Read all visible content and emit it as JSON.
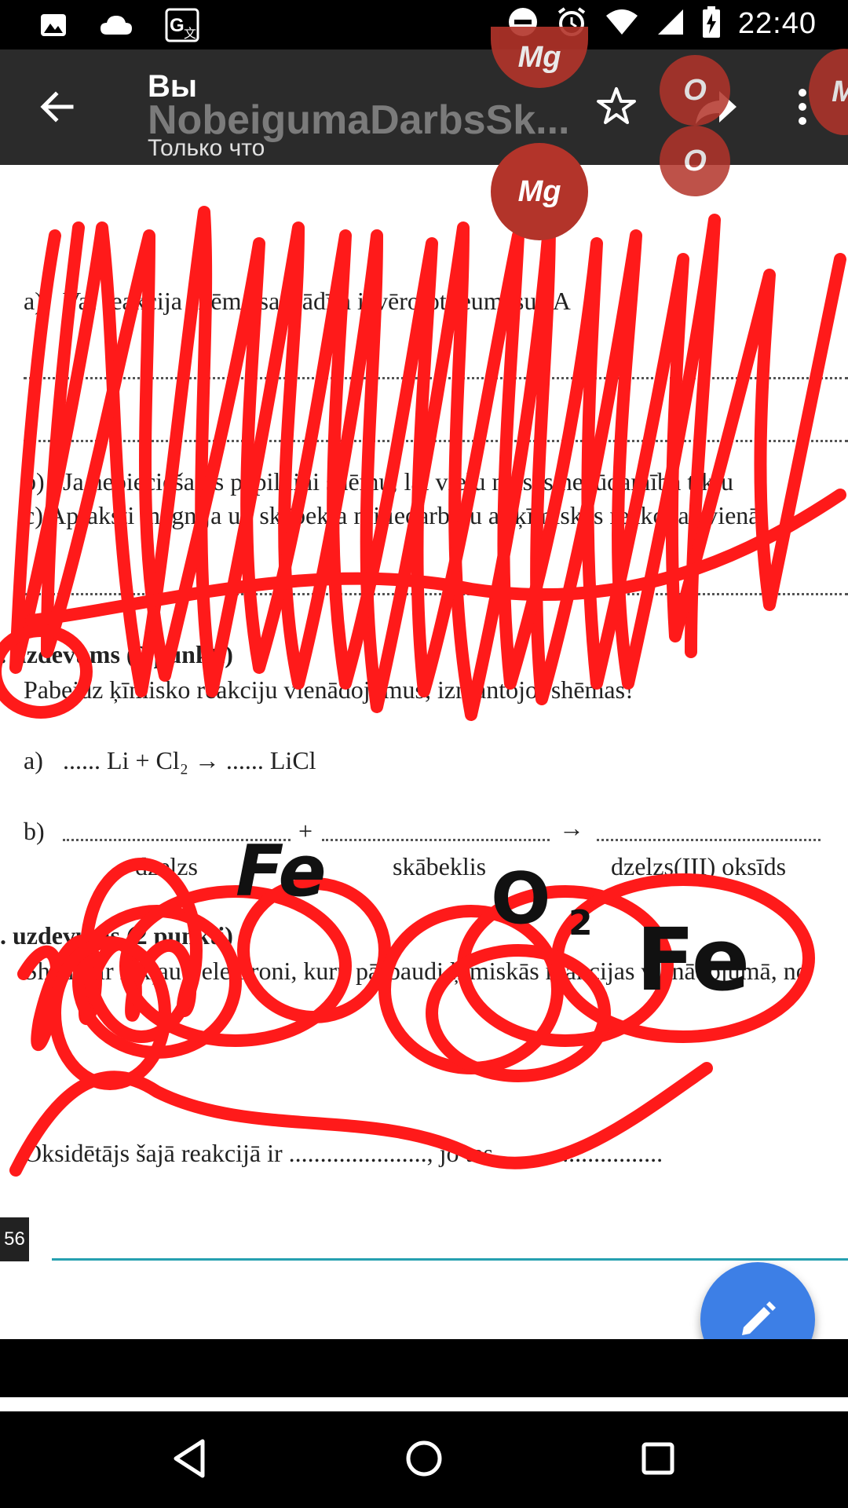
{
  "status_bar": {
    "time": "22:40",
    "icons": [
      "image-icon",
      "cloud-icon",
      "translate-icon",
      "dnd-icon",
      "alarm-icon",
      "wifi-icon",
      "signal-icon",
      "battery-charging-icon"
    ]
  },
  "app_bar": {
    "sender": "Вы",
    "document_title": "NobeigumaDarbsSk...",
    "time_label": "Только что"
  },
  "document": {
    "line_a": "a)",
    "line_a_text": "Vai reakcija shēma sasvādīta ievērojot ieumasu? A",
    "line_b": "b)",
    "line_b_text": "Ja nepieciešams papildini shēmu, lai vielu masas nezūdamība tiktu",
    "line_c_text": "c) Apraksti magnija un skābekļa mijiedarbību ar ķīmiskās reakcijas vienā",
    "task_heading": ". uzdevums (2 punkti)",
    "task_instruction": "Pabeidz ķīmisko reakciju vienādojumus, izmantojot shēmas!",
    "eq_a_label": "a)",
    "eq_a": "...... Li + Cl₂ → ...... LiCl",
    "eq_b_label": "b)",
    "plus": "+",
    "arrow": "→",
    "label_iron": "dzelzs",
    "label_oxygen": "skābeklis",
    "label_oxide": "dzelzs(III) oksīds",
    "task2_heading": ". uzdevums (2 punkti)",
    "task2_instruction": "Shēmā ir iekļauti elektroni, kuru pārbaudi ķīmiskās reakcijas vienādojumā, no",
    "oxidizer_line": "Oksidētājs šajā reakcijā ir ......................, jo tas ..........................",
    "page_number": "56"
  },
  "handwriting": {
    "fe1": "Fe",
    "o2": "O",
    "sub2": "2",
    "fe2": "Fe"
  },
  "bubbles": {
    "mg_top": "Mg",
    "mg_main": "Mg",
    "o_top": "O",
    "o_mid": "O",
    "m_right": "M"
  },
  "colors": {
    "scribble": "#ff1a1a",
    "fab": "#3d7fe6",
    "app_bar": "#2b2b2b",
    "bubble": "#b3342a"
  }
}
